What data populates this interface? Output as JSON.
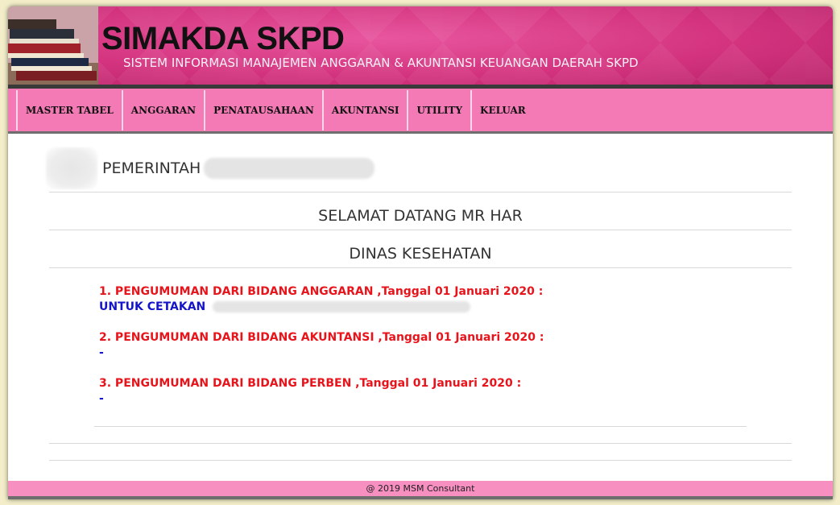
{
  "header": {
    "app_title": "SIMAKDA SKPD",
    "app_subtitle": "SISTEM INFORMASI MANAJEMEN ANGGARAN & AKUNTANSI KEUANGAN DAERAH SKPD",
    "banner_color": "#d4347f",
    "books_icon": "books-icon"
  },
  "nav": {
    "items": [
      {
        "label": "MASTER TABEL"
      },
      {
        "label": "ANGGARAN"
      },
      {
        "label": "PENATAUSAHAAN"
      },
      {
        "label": "AKUNTANSI"
      },
      {
        "label": "UTILITY"
      },
      {
        "label": "KELUAR"
      }
    ],
    "bg_color": "#f47ab5"
  },
  "main": {
    "org_label": "PEMERINTAH",
    "welcome": "SELAMAT DATANG MR HAR",
    "department": "DINAS KESEHATAN",
    "announcements": [
      {
        "heading": "1. PENGUMUMAN DARI BIDANG ANGGARAN ,Tanggal 01 Januari 2020 :",
        "body": "UNTUK CETAKAN"
      },
      {
        "heading": "2. PENGUMUMAN DARI BIDANG AKUNTANSI ,Tanggal 01 Januari 2020 :",
        "body": "-"
      },
      {
        "heading": "3. PENGUMUMAN DARI BIDANG PERBEN ,Tanggal 01 Januari 2020 :",
        "body": "-"
      }
    ],
    "heading_color": "#e8141b",
    "body_color": "#1414c8"
  },
  "footer": {
    "text": "@ 2019 MSM Consultant",
    "bg_color": "#f78fc1"
  }
}
